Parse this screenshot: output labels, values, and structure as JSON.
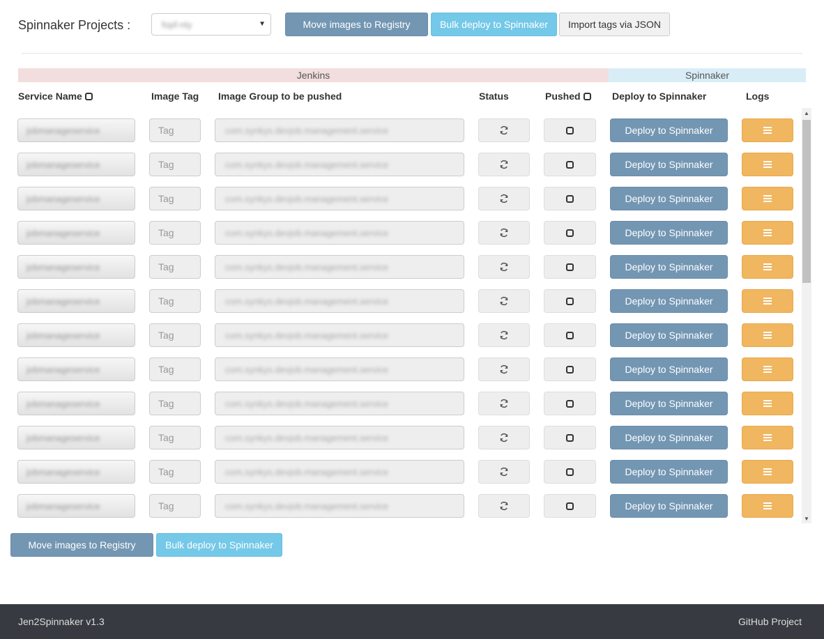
{
  "header": {
    "projects_label": "Spinnaker Projects :",
    "project_selected": "fopf-nty",
    "move_images_label": "Move images to Registry",
    "bulk_deploy_label": "Bulk deploy to Spinnaker",
    "import_tags_label": "Import tags via JSON"
  },
  "groups": {
    "jenkins": "Jenkins",
    "spinnaker": "Spinnaker"
  },
  "columns": {
    "service_name": "Service Name",
    "image_tag": "Image Tag",
    "image_group": "Image Group to be pushed",
    "status": "Status",
    "pushed": "Pushed",
    "deploy": "Deploy to Spinnaker",
    "logs": "Logs"
  },
  "rows": [
    {
      "service": "jobmanageservice",
      "tag_placeholder": "Tag",
      "group": "com.synkys.devjob.management.service",
      "deploy_label": "Deploy to Spinnaker"
    },
    {
      "service": "jobmanageservice",
      "tag_placeholder": "Tag",
      "group": "com.synkys.devjob.management.service",
      "deploy_label": "Deploy to Spinnaker"
    },
    {
      "service": "jobmanageservice",
      "tag_placeholder": "Tag",
      "group": "com.synkys.devjob.management.service",
      "deploy_label": "Deploy to Spinnaker"
    },
    {
      "service": "jobmanageservice",
      "tag_placeholder": "Tag",
      "group": "com.synkys.devjob.management.service",
      "deploy_label": "Deploy to Spinnaker"
    },
    {
      "service": "jobmanageservice",
      "tag_placeholder": "Tag",
      "group": "com.synkys.devjob.management.service",
      "deploy_label": "Deploy to Spinnaker"
    },
    {
      "service": "jobmanageservice",
      "tag_placeholder": "Tag",
      "group": "com.synkys.devjob.management.service",
      "deploy_label": "Deploy to Spinnaker"
    },
    {
      "service": "jobmanageservice",
      "tag_placeholder": "Tag",
      "group": "com.synkys.devjob.management.service",
      "deploy_label": "Deploy to Spinnaker"
    },
    {
      "service": "jobmanageservice",
      "tag_placeholder": "Tag",
      "group": "com.synkys.devjob.management.service",
      "deploy_label": "Deploy to Spinnaker"
    },
    {
      "service": "jobmanageservice",
      "tag_placeholder": "Tag",
      "group": "com.synkys.devjob.management.service",
      "deploy_label": "Deploy to Spinnaker"
    },
    {
      "service": "jobmanageservice",
      "tag_placeholder": "Tag",
      "group": "com.synkys.devjob.management.service",
      "deploy_label": "Deploy to Spinnaker"
    },
    {
      "service": "jobmanageservice",
      "tag_placeholder": "Tag",
      "group": "com.synkys.devjob.management.service",
      "deploy_label": "Deploy to Spinnaker"
    },
    {
      "service": "jobmanageservice",
      "tag_placeholder": "Tag",
      "group": "com.synkys.devjob.management.service",
      "deploy_label": "Deploy to Spinnaker"
    }
  ],
  "bottom": {
    "move_images_label": "Move images to Registry",
    "bulk_deploy_label": "Bulk deploy to Spinnaker"
  },
  "footer": {
    "version": "Jen2Spinnaker v1.3",
    "github_link": "GitHub Project"
  },
  "icons": {
    "status": "refresh-icon",
    "pushed": "checkbox-icon",
    "logs": "list-icon",
    "select": "caret-down-icon"
  },
  "colors": {
    "primary_button": "#7396b3",
    "info_button": "#74c8e8",
    "warning_button": "#f0b660",
    "jenkins_header": "#f2dede",
    "spinnaker_header": "#d9edf7",
    "footer_bg": "#373b41"
  }
}
